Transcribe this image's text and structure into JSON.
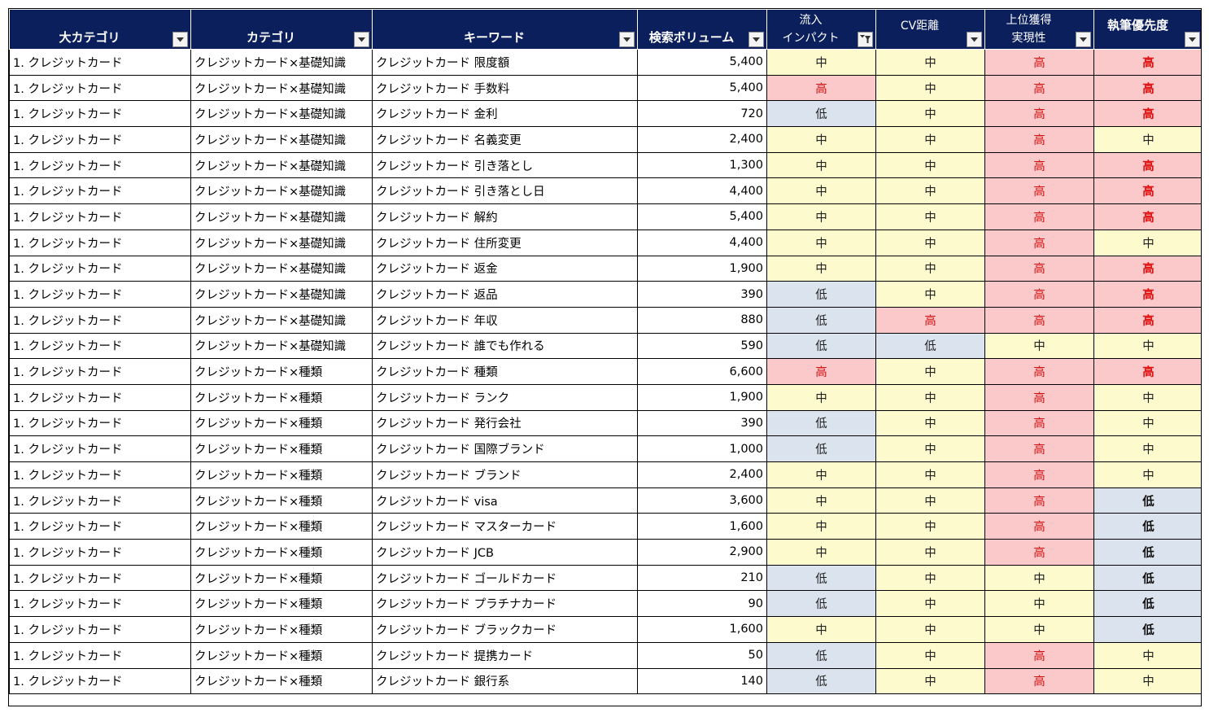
{
  "headers": [
    {
      "label": "大カテゴリ",
      "filter": "dropdown"
    },
    {
      "label": "カテゴリ",
      "filter": "dropdown"
    },
    {
      "label": "キーワード",
      "filter": "dropdown"
    },
    {
      "label": "検索ボリューム",
      "filter": "dropdown"
    },
    {
      "label": "流入\nインパクト",
      "filter": "filtered"
    },
    {
      "label": "CV距離",
      "filter": "dropdown"
    },
    {
      "label": "上位獲得\n実現性",
      "filter": "dropdown"
    },
    {
      "label": "執筆優先度",
      "filter": "dropdown"
    }
  ],
  "rows": [
    [
      "1.  クレジットカード",
      "クレジットカード×基礎知識",
      "クレジットカード 限度額",
      "5,400",
      "中",
      "中",
      "高",
      "高"
    ],
    [
      "1.  クレジットカード",
      "クレジットカード×基礎知識",
      "クレジットカード 手数料",
      "5,400",
      "高",
      "中",
      "高",
      "高"
    ],
    [
      "1.  クレジットカード",
      "クレジットカード×基礎知識",
      "クレジットカード 金利",
      "720",
      "低",
      "中",
      "高",
      "高"
    ],
    [
      "1.  クレジットカード",
      "クレジットカード×基礎知識",
      "クレジットカード 名義変更",
      "2,400",
      "中",
      "中",
      "高",
      "中"
    ],
    [
      "1.  クレジットカード",
      "クレジットカード×基礎知識",
      "クレジットカード 引き落とし",
      "1,300",
      "中",
      "中",
      "高",
      "高"
    ],
    [
      "1.  クレジットカード",
      "クレジットカード×基礎知識",
      "クレジットカード 引き落とし日",
      "4,400",
      "中",
      "中",
      "高",
      "高"
    ],
    [
      "1.  クレジットカード",
      "クレジットカード×基礎知識",
      "クレジットカード 解約",
      "5,400",
      "中",
      "中",
      "高",
      "高"
    ],
    [
      "1.  クレジットカード",
      "クレジットカード×基礎知識",
      "クレジットカード 住所変更",
      "4,400",
      "中",
      "中",
      "高",
      "中"
    ],
    [
      "1.  クレジットカード",
      "クレジットカード×基礎知識",
      "クレジットカード 返金",
      "1,900",
      "中",
      "中",
      "高",
      "高"
    ],
    [
      "1.  クレジットカード",
      "クレジットカード×基礎知識",
      "クレジットカード 返品",
      "390",
      "低",
      "中",
      "高",
      "高"
    ],
    [
      "1.  クレジットカード",
      "クレジットカード×基礎知識",
      "クレジットカード 年収",
      "880",
      "低",
      "高",
      "高",
      "高"
    ],
    [
      "1.  クレジットカード",
      "クレジットカード×基礎知識",
      "クレジットカード 誰でも作れる",
      "590",
      "低",
      "低",
      "中",
      "中"
    ],
    [
      "1.  クレジットカード",
      "クレジットカード×種類",
      "クレジットカード 種類",
      "6,600",
      "高",
      "中",
      "高",
      "高"
    ],
    [
      "1.  クレジットカード",
      "クレジットカード×種類",
      "クレジットカード ランク",
      "1,900",
      "中",
      "中",
      "高",
      "中"
    ],
    [
      "1.  クレジットカード",
      "クレジットカード×種類",
      "クレジットカード 発行会社",
      "390",
      "低",
      "中",
      "高",
      "中"
    ],
    [
      "1.  クレジットカード",
      "クレジットカード×種類",
      "クレジットカード 国際ブランド",
      "1,000",
      "低",
      "中",
      "高",
      "中"
    ],
    [
      "1.  クレジットカード",
      "クレジットカード×種類",
      "クレジットカード ブランド",
      "2,400",
      "中",
      "中",
      "高",
      "中"
    ],
    [
      "1.  クレジットカード",
      "クレジットカード×種類",
      "クレジットカード visa",
      "3,600",
      "中",
      "中",
      "高",
      "低"
    ],
    [
      "1.  クレジットカード",
      "クレジットカード×種類",
      "クレジットカード マスターカード",
      "1,600",
      "中",
      "中",
      "高",
      "低"
    ],
    [
      "1.  クレジットカード",
      "クレジットカード×種類",
      "クレジットカード JCB",
      "2,900",
      "中",
      "中",
      "高",
      "低"
    ],
    [
      "1.  クレジットカード",
      "クレジットカード×種類",
      "クレジットカード ゴールドカード",
      "210",
      "低",
      "中",
      "中",
      "低"
    ],
    [
      "1.  クレジットカード",
      "クレジットカード×種類",
      "クレジットカード プラチナカード",
      "90",
      "低",
      "中",
      "中",
      "低"
    ],
    [
      "1.  クレジットカード",
      "クレジットカード×種類",
      "クレジットカード ブラックカード",
      "1,600",
      "中",
      "中",
      "中",
      "低"
    ],
    [
      "1.  クレジットカード",
      "クレジットカード×種類",
      "クレジットカード 提携カード",
      "50",
      "低",
      "中",
      "高",
      "中"
    ],
    [
      "1.  クレジットカード",
      "クレジットカード×種類",
      "クレジットカード 銀行系",
      "140",
      "低",
      "中",
      "高",
      "中"
    ]
  ],
  "colors": {
    "header_bg": "#0b1f5c",
    "high_bg": "#fcc9cb",
    "mid_bg": "#fdfbcd",
    "low_bg": "#dbe3ee",
    "high_text": "#d01010"
  },
  "icons": {
    "filter_dropdown": "dropdown-arrow-icon",
    "filter_active": "filter-funnel-icon"
  }
}
